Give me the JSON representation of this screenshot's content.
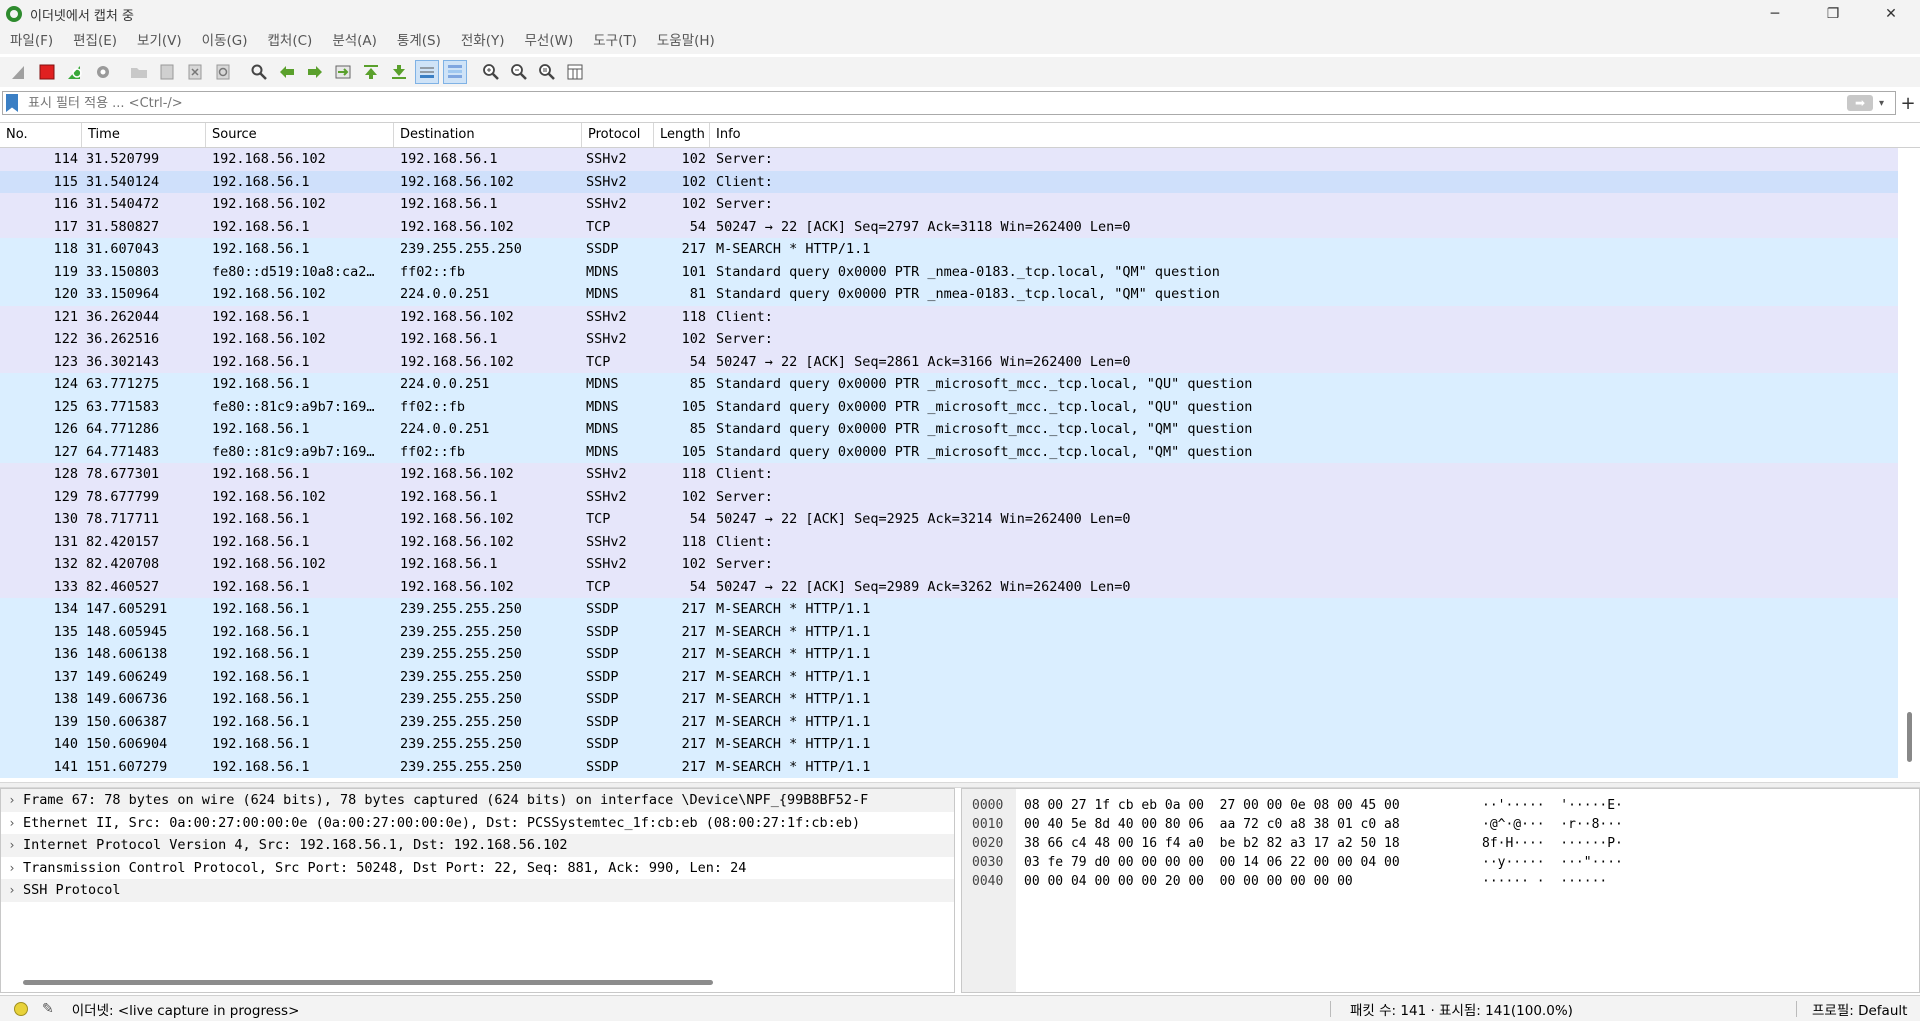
{
  "window": {
    "title": "이더넷에서 캡처 중",
    "controls": [
      "─",
      "❐",
      "✕"
    ]
  },
  "menu": [
    "파일(F)",
    "편집(E)",
    "보기(V)",
    "이동(G)",
    "캡처(C)",
    "분석(A)",
    "통계(S)",
    "전화(Y)",
    "무선(W)",
    "도구(T)",
    "도움말(H)"
  ],
  "filter": {
    "placeholder": "표시 필터 적용 ... <Ctrl-/>",
    "apply_glyph": "➡",
    "add_glyph": "+"
  },
  "columns": [
    "No.",
    "Time",
    "Source",
    "Destination",
    "Protocol",
    "Length",
    "Info"
  ],
  "packets": [
    {
      "no": "114",
      "time": "31.520799",
      "src": "192.168.56.102",
      "dst": "192.168.56.1",
      "proto": "SSHv2",
      "len": "102",
      "info": "Server:",
      "kind": "ssh"
    },
    {
      "no": "115",
      "time": "31.540124",
      "src": "192.168.56.1",
      "dst": "192.168.56.102",
      "proto": "SSHv2",
      "len": "102",
      "info": "Client:",
      "kind": "sel"
    },
    {
      "no": "116",
      "time": "31.540472",
      "src": "192.168.56.102",
      "dst": "192.168.56.1",
      "proto": "SSHv2",
      "len": "102",
      "info": "Server:",
      "kind": "ssh"
    },
    {
      "no": "117",
      "time": "31.580827",
      "src": "192.168.56.1",
      "dst": "192.168.56.102",
      "proto": "TCP",
      "len": "54",
      "info": "50247 → 22 [ACK] Seq=2797 Ack=3118 Win=262400 Len=0",
      "kind": "tcp"
    },
    {
      "no": "118",
      "time": "31.607043",
      "src": "192.168.56.1",
      "dst": "239.255.255.250",
      "proto": "SSDP",
      "len": "217",
      "info": "M-SEARCH * HTTP/1.1",
      "kind": "udp"
    },
    {
      "no": "119",
      "time": "33.150803",
      "src": "fe80::d519:10a8:ca2…",
      "dst": "ff02::fb",
      "proto": "MDNS",
      "len": "101",
      "info": "Standard query 0x0000 PTR _nmea-0183._tcp.local, \"QM\" question",
      "kind": "udp"
    },
    {
      "no": "120",
      "time": "33.150964",
      "src": "192.168.56.102",
      "dst": "224.0.0.251",
      "proto": "MDNS",
      "len": "81",
      "info": "Standard query 0x0000 PTR _nmea-0183._tcp.local, \"QM\" question",
      "kind": "udp"
    },
    {
      "no": "121",
      "time": "36.262044",
      "src": "192.168.56.1",
      "dst": "192.168.56.102",
      "proto": "SSHv2",
      "len": "118",
      "info": "Client:",
      "kind": "ssh"
    },
    {
      "no": "122",
      "time": "36.262516",
      "src": "192.168.56.102",
      "dst": "192.168.56.1",
      "proto": "SSHv2",
      "len": "102",
      "info": "Server:",
      "kind": "ssh"
    },
    {
      "no": "123",
      "time": "36.302143",
      "src": "192.168.56.1",
      "dst": "192.168.56.102",
      "proto": "TCP",
      "len": "54",
      "info": "50247 → 22 [ACK] Seq=2861 Ack=3166 Win=262400 Len=0",
      "kind": "tcp"
    },
    {
      "no": "124",
      "time": "63.771275",
      "src": "192.168.56.1",
      "dst": "224.0.0.251",
      "proto": "MDNS",
      "len": "85",
      "info": "Standard query 0x0000 PTR _microsoft_mcc._tcp.local, \"QU\" question",
      "kind": "udp"
    },
    {
      "no": "125",
      "time": "63.771583",
      "src": "fe80::81c9:a9b7:169…",
      "dst": "ff02::fb",
      "proto": "MDNS",
      "len": "105",
      "info": "Standard query 0x0000 PTR _microsoft_mcc._tcp.local, \"QU\" question",
      "kind": "udp"
    },
    {
      "no": "126",
      "time": "64.771286",
      "src": "192.168.56.1",
      "dst": "224.0.0.251",
      "proto": "MDNS",
      "len": "85",
      "info": "Standard query 0x0000 PTR _microsoft_mcc._tcp.local, \"QM\" question",
      "kind": "udp"
    },
    {
      "no": "127",
      "time": "64.771483",
      "src": "fe80::81c9:a9b7:169…",
      "dst": "ff02::fb",
      "proto": "MDNS",
      "len": "105",
      "info": "Standard query 0x0000 PTR _microsoft_mcc._tcp.local, \"QM\" question",
      "kind": "udp"
    },
    {
      "no": "128",
      "time": "78.677301",
      "src": "192.168.56.1",
      "dst": "192.168.56.102",
      "proto": "SSHv2",
      "len": "118",
      "info": "Client:",
      "kind": "ssh"
    },
    {
      "no": "129",
      "time": "78.677799",
      "src": "192.168.56.102",
      "dst": "192.168.56.1",
      "proto": "SSHv2",
      "len": "102",
      "info": "Server:",
      "kind": "ssh"
    },
    {
      "no": "130",
      "time": "78.717711",
      "src": "192.168.56.1",
      "dst": "192.168.56.102",
      "proto": "TCP",
      "len": "54",
      "info": "50247 → 22 [ACK] Seq=2925 Ack=3214 Win=262400 Len=0",
      "kind": "tcp"
    },
    {
      "no": "131",
      "time": "82.420157",
      "src": "192.168.56.1",
      "dst": "192.168.56.102",
      "proto": "SSHv2",
      "len": "118",
      "info": "Client:",
      "kind": "ssh"
    },
    {
      "no": "132",
      "time": "82.420708",
      "src": "192.168.56.102",
      "dst": "192.168.56.1",
      "proto": "SSHv2",
      "len": "102",
      "info": "Server:",
      "kind": "ssh"
    },
    {
      "no": "133",
      "time": "82.460527",
      "src": "192.168.56.1",
      "dst": "192.168.56.102",
      "proto": "TCP",
      "len": "54",
      "info": "50247 → 22 [ACK] Seq=2989 Ack=3262 Win=262400 Len=0",
      "kind": "tcp"
    },
    {
      "no": "134",
      "time": "147.605291",
      "src": "192.168.56.1",
      "dst": "239.255.255.250",
      "proto": "SSDP",
      "len": "217",
      "info": "M-SEARCH * HTTP/1.1",
      "kind": "udp"
    },
    {
      "no": "135",
      "time": "148.605945",
      "src": "192.168.56.1",
      "dst": "239.255.255.250",
      "proto": "SSDP",
      "len": "217",
      "info": "M-SEARCH * HTTP/1.1",
      "kind": "udp"
    },
    {
      "no": "136",
      "time": "148.606138",
      "src": "192.168.56.1",
      "dst": "239.255.255.250",
      "proto": "SSDP",
      "len": "217",
      "info": "M-SEARCH * HTTP/1.1",
      "kind": "udp"
    },
    {
      "no": "137",
      "time": "149.606249",
      "src": "192.168.56.1",
      "dst": "239.255.255.250",
      "proto": "SSDP",
      "len": "217",
      "info": "M-SEARCH * HTTP/1.1",
      "kind": "udp"
    },
    {
      "no": "138",
      "time": "149.606736",
      "src": "192.168.56.1",
      "dst": "239.255.255.250",
      "proto": "SSDP",
      "len": "217",
      "info": "M-SEARCH * HTTP/1.1",
      "kind": "udp"
    },
    {
      "no": "139",
      "time": "150.606387",
      "src": "192.168.56.1",
      "dst": "239.255.255.250",
      "proto": "SSDP",
      "len": "217",
      "info": "M-SEARCH * HTTP/1.1",
      "kind": "udp"
    },
    {
      "no": "140",
      "time": "150.606904",
      "src": "192.168.56.1",
      "dst": "239.255.255.250",
      "proto": "SSDP",
      "len": "217",
      "info": "M-SEARCH * HTTP/1.1",
      "kind": "udp"
    },
    {
      "no": "141",
      "time": "151.607279",
      "src": "192.168.56.1",
      "dst": "239.255.255.250",
      "proto": "SSDP",
      "len": "217",
      "info": "M-SEARCH * HTTP/1.1",
      "kind": "udp"
    }
  ],
  "details": [
    "Frame 67: 78 bytes on wire (624 bits), 78 bytes captured (624 bits) on interface \\Device\\NPF_{99B8BF52-F",
    "Ethernet II, Src: 0a:00:27:00:00:0e (0a:00:27:00:00:0e), Dst: PCSSystemtec_1f:cb:eb (08:00:27:1f:cb:eb)",
    "Internet Protocol Version 4, Src: 192.168.56.1, Dst: 192.168.56.102",
    "Transmission Control Protocol, Src Port: 50248, Dst Port: 22, Seq: 881, Ack: 990, Len: 24",
    "SSH Protocol"
  ],
  "bytes": [
    {
      "off": "0000",
      "hex": "08 00 27 1f cb eb 0a 00  27 00 00 0e 08 00 45 00",
      "ascii": "··'·····  '·····E·"
    },
    {
      "off": "0010",
      "hex": "00 40 5e 8d 40 00 80 06  aa 72 c0 a8 38 01 c0 a8",
      "ascii": "·@^·@···  ·r··8···"
    },
    {
      "off": "0020",
      "hex": "38 66 c4 48 00 16 f4 a0  be b2 82 a3 17 a2 50 18",
      "ascii": "8f·H····  ······P·"
    },
    {
      "off": "0030",
      "hex": "03 fe 79 d0 00 00 00 00  00 14 06 22 00 00 04 00",
      "ascii": "··y·····  ···\"····"
    },
    {
      "off": "0040",
      "hex": "00 00 04 00 00 00 20 00  00 00 00 00 00 00",
      "ascii": "······ ·  ······"
    }
  ],
  "status": {
    "capture": "이더넷: <live capture in progress>",
    "count": "패킷 수: 141 · 표시됨: 141(100.0%)",
    "profile": "프로필: Default"
  },
  "colors": {
    "ssh_row": "#e6e6fa",
    "udp_row": "#daeeff",
    "selected_row": "#cfe0fb",
    "status_led": "#e8d23a"
  },
  "toolbar_icons": [
    "shark-fin-icon",
    "stop-icon",
    "restart-icon",
    "options-gear-icon",
    "open-folder-icon",
    "save-icon",
    "close-file-icon",
    "reload-icon",
    "find-icon",
    "go-back-icon",
    "go-forward-icon",
    "go-to-packet-icon",
    "first-packet-icon",
    "last-packet-icon",
    "autoscroll-icon",
    "colorize-icon",
    "zoom-in-icon",
    "zoom-out-icon",
    "zoom-reset-icon",
    "resize-columns-icon"
  ]
}
